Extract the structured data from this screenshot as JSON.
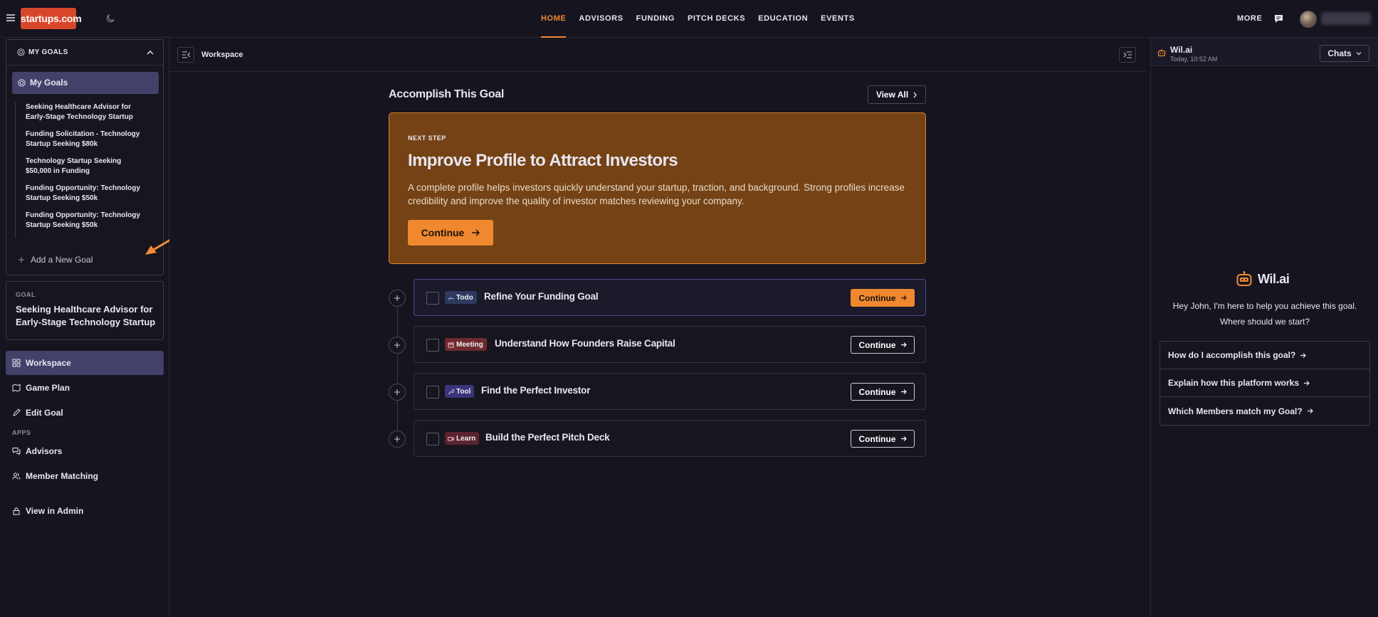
{
  "topnav": {
    "logo": "startups.com",
    "links": [
      "HOME",
      "ADVISORS",
      "FUNDING",
      "PITCH DECKS",
      "EDUCATION",
      "EVENTS"
    ],
    "active": "HOME",
    "more": "MORE"
  },
  "sidebar": {
    "goals_header": "MY GOALS",
    "my_goals": "My Goals",
    "goals": [
      "Seeking Healthcare Advisor for Early-Stage Technology Startup",
      "Funding Solicitation - Technology Startup Seeking $80k",
      "Technology Startup Seeking $50,000 in Funding",
      "Funding Opportunity: Technology Startup Seeking $50k",
      "Funding Opportunity: Technology Startup Seeking $50k"
    ],
    "add_goal": "Add a New Goal",
    "goal_label": "GOAL",
    "goal_text": "Seeking Healthcare Advisor for Early-Stage Technology Startup",
    "nav": {
      "workspace": "Workspace",
      "game_plan": "Game Plan",
      "edit_goal": "Edit Goal",
      "apps_label": "APPS",
      "advisors": "Advisors",
      "member_matching": "Member Matching",
      "view_in_admin": "View in Admin"
    }
  },
  "workspace": {
    "title": "Workspace",
    "section_title": "Accomplish This Goal",
    "view_all": "View All",
    "hero": {
      "eyebrow": "NEXT STEP",
      "title": "Improve Profile to Attract Investors",
      "body": "A complete profile helps investors quickly understand your startup, traction, and background. Strong profiles increase credibility and improve the quality of investor matches reviewing your company.",
      "button": "Continue"
    },
    "tasks": [
      {
        "tag": "Todo",
        "name": "Refine Your Funding Goal",
        "button": "Continue"
      },
      {
        "tag": "Meeting",
        "name": "Understand How Founders Raise Capital",
        "button": "Continue"
      },
      {
        "tag": "Tool",
        "name": "Find the Perfect Investor",
        "button": "Continue"
      },
      {
        "tag": "Learn",
        "name": "Build the Perfect Pitch Deck",
        "button": "Continue"
      }
    ]
  },
  "chat": {
    "name": "Wil.ai",
    "time": "Today, 10:52 AM",
    "chats_button": "Chats",
    "logo_text": "Wil.ai",
    "greeting_line1": "Hey John, I'm here to help you achieve this goal.",
    "greeting_line2": "Where should we start?",
    "suggestions": [
      "How do I accomplish this goal?",
      "Explain how this platform works",
      "Which Members match my Goal?"
    ]
  },
  "colors": {
    "background": "#15141f",
    "accent": "#f08a35",
    "logo_red": "#d9472b",
    "hero_bg": "#744214",
    "active_nav": "#43416a"
  }
}
